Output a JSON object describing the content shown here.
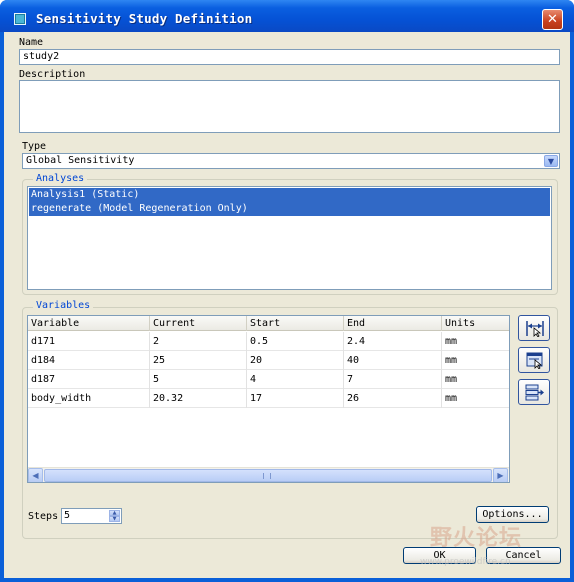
{
  "window": {
    "title": "Sensitivity Study Definition",
    "close_label": "✕"
  },
  "name_field": {
    "label": "Name",
    "value": "study2"
  },
  "description_field": {
    "label": "Description",
    "value": ""
  },
  "type_field": {
    "label": "Type",
    "value": "Global Sensitivity"
  },
  "analyses": {
    "title": "Analyses",
    "items": [
      {
        "label": "Analysis1 (Static)",
        "selected": true
      },
      {
        "label": "regenerate (Model Regeneration Only)",
        "selected": true
      }
    ]
  },
  "variables": {
    "title": "Variables",
    "columns": [
      "Variable",
      "Current",
      "Start",
      "End",
      "Units"
    ],
    "rows": [
      [
        "d171",
        "2",
        "0.5",
        "2.4",
        "mm"
      ],
      [
        "d184",
        "25",
        "20",
        "40",
        "mm"
      ],
      [
        "d187",
        "5",
        "4",
        "7",
        "mm"
      ],
      [
        "body_width",
        "20.32",
        "17",
        "26",
        "mm"
      ]
    ],
    "side_buttons": [
      "add-dimension-icon",
      "select-from-model-icon",
      "add-parameter-icon"
    ]
  },
  "steps": {
    "label": "Steps",
    "value": "5"
  },
  "buttons": {
    "options": "Options...",
    "ok": "OK",
    "cancel": "Cancel"
  },
  "watermark": {
    "text": "野火论坛",
    "url": "www.proewildfire.cn"
  },
  "colors": {
    "selection": "#3169c6",
    "group_title": "#0046d5",
    "titlebar": "#0a5fd8"
  }
}
